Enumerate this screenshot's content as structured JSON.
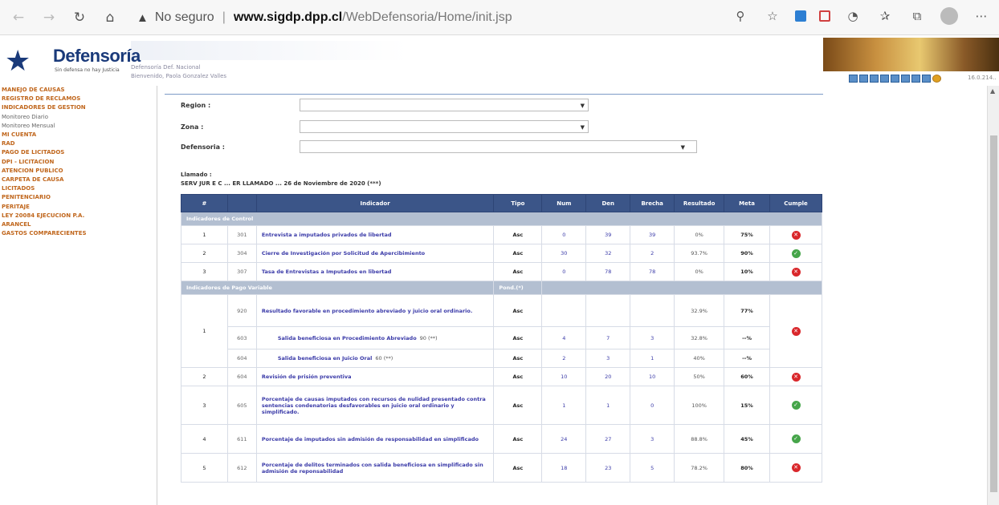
{
  "browser": {
    "security_icon": "warning-triangle-icon",
    "security_label": "No seguro",
    "separator": "|",
    "domain": "www.sigdp.dpp.cl",
    "path": "/WebDefensoria/Home/init.jsp"
  },
  "header": {
    "logo_name": "Defensoría",
    "logo_tagline": "Sin defensa no hay Justicia",
    "line1": "Defensoría  Def. Nacional",
    "line2": "Bienvenido, Paola Gonzalez Valles",
    "ip_text": "16.0.214.."
  },
  "sidebar": {
    "items": [
      {
        "label": "MANEJO DE CAUSAS",
        "style": "link"
      },
      {
        "label": "REGISTRO DE RECLAMOS",
        "style": "link"
      },
      {
        "label": "INDICADORES DE GESTION",
        "style": "link"
      },
      {
        "label": "Monitoreo Diario",
        "style": "plain"
      },
      {
        "label": "Monitoreo Mensual",
        "style": "plain"
      },
      {
        "label": "MI CUENTA",
        "style": "link"
      },
      {
        "label": "RAD",
        "style": "link"
      },
      {
        "label": "PAGO DE LICITADOS",
        "style": "link"
      },
      {
        "label": "DPI - LICITACION",
        "style": "link"
      },
      {
        "label": "ATENCION PUBLICO",
        "style": "link"
      },
      {
        "label": "CARPETA DE CAUSA",
        "style": "link"
      },
      {
        "label": "LICITADOS",
        "style": "link"
      },
      {
        "label": "PENITENCIARIO",
        "style": "link"
      },
      {
        "label": "PERITAJE",
        "style": "link"
      },
      {
        "label": "LEY 20084 EJECUCION P.A.",
        "style": "link"
      },
      {
        "label": "ARANCEL",
        "style": "link"
      },
      {
        "label": "GASTOS COMPARECIENTES",
        "style": "link"
      }
    ]
  },
  "filters": {
    "region_label": "Region :",
    "zona_label": "Zona :",
    "defensoria_label": "Defensoria :",
    "dropdown_arrow": "▼"
  },
  "llamado": {
    "line1": "Llamado :",
    "line2": "SERV JUR E C ... ER LLAMADO ... 26 de Noviembre de 2020 (***)"
  },
  "table": {
    "headers": [
      "#",
      "",
      "Indicador",
      "Tipo",
      "Num",
      "Den",
      "Brecha",
      "Resultado",
      "Meta",
      "Cumple"
    ],
    "section_control": "Indicadores de Control",
    "section_pago": "Indicadores de Pago Variable",
    "section_pond": "Pond.(*)",
    "control_rows": [
      {
        "n": "1",
        "code": "301",
        "name": "Entrevista a imputados privados de libertad",
        "tipo": "Asc",
        "num": "0",
        "den": "39",
        "brecha": "39",
        "res": "0%",
        "meta": "75%",
        "ok": false
      },
      {
        "n": "2",
        "code": "304",
        "name": "Cierre de Investigación por Solicitud de Apercibimiento",
        "tipo": "Asc",
        "num": "30",
        "den": "32",
        "brecha": "2",
        "res": "93.7%",
        "meta": "90%",
        "ok": true
      },
      {
        "n": "3",
        "code": "307",
        "name": "Tasa de Entrevistas a Imputados en libertad",
        "tipo": "Asc",
        "num": "0",
        "den": "78",
        "brecha": "78",
        "res": "0%",
        "meta": "10%",
        "ok": false
      }
    ],
    "pago_block1": {
      "n": "1",
      "main": {
        "code": "920",
        "name": "Resultado favorable en procedimiento abreviado y juicio oral ordinario.",
        "tipo": "Asc",
        "res": "32.9%",
        "meta": "77%"
      },
      "sub1": {
        "code": "603",
        "name": "Salida beneficiosa en Procedimiento Abreviado",
        "pond": "90 (**)",
        "tipo": "Asc",
        "num": "4",
        "den": "7",
        "brecha": "3",
        "res": "32.8%",
        "meta": "--%"
      },
      "sub2": {
        "code": "604",
        "name": "Salida beneficiosa en Juicio Oral",
        "pond": "60 (**)",
        "tipo": "Asc",
        "num": "2",
        "den": "3",
        "brecha": "1",
        "res": "40%",
        "meta": "--%"
      },
      "ok": false
    },
    "pago_rows": [
      {
        "n": "2",
        "code": "604",
        "name": "Revisión de prisión preventiva",
        "tipo": "Asc",
        "num": "10",
        "den": "20",
        "brecha": "10",
        "res": "50%",
        "meta": "60%",
        "ok": false
      },
      {
        "n": "3",
        "code": "605",
        "name": "Porcentaje de causas imputados con recursos de nulidad presentado contra sentencias condenatorias desfavorables en juicio oral ordinario y simplificado.",
        "tipo": "Asc",
        "num": "1",
        "den": "1",
        "brecha": "0",
        "res": "100%",
        "meta": "15%",
        "ok": true
      },
      {
        "n": "4",
        "code": "611",
        "name": "Porcentaje de imputados sin admisión de responsabilidad en simplificado",
        "tipo": "Asc",
        "num": "24",
        "den": "27",
        "brecha": "3",
        "res": "88.8%",
        "meta": "45%",
        "ok": true
      },
      {
        "n": "5",
        "code": "612",
        "name": "Porcentaje de delitos terminados con salida beneficiosa en simplificado sin admisión de reponsabilidad",
        "tipo": "Asc",
        "num": "18",
        "den": "23",
        "brecha": "5",
        "res": "78.2%",
        "meta": "80%",
        "ok": false
      }
    ],
    "ok_glyph": "✓",
    "fail_glyph": "✕"
  },
  "colors": {
    "header_blue": "#3b5588",
    "section_bg": "#b3bfd1",
    "link_blue": "#3a3aa8",
    "sidebar_orange": "#c0661c",
    "fail_red": "#d9272b",
    "ok_green": "#46a54a"
  }
}
